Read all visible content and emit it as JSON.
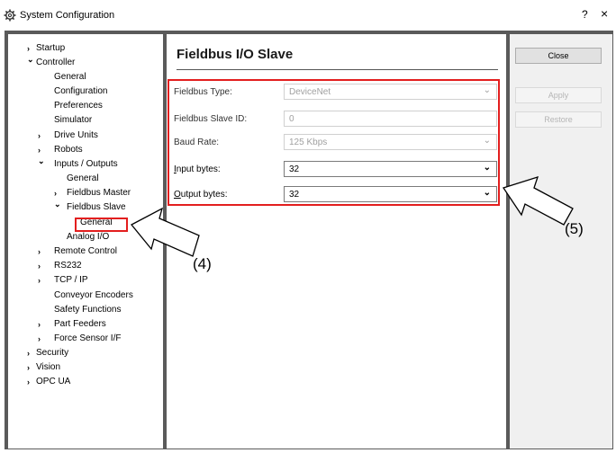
{
  "window": {
    "title": "System Configuration",
    "help": "?",
    "close": "×"
  },
  "tree": {
    "items": [
      {
        "label": "Startup",
        "chevron": "›"
      },
      {
        "label": "Controller",
        "chevron": "⌄"
      },
      {
        "label": "General"
      },
      {
        "label": "Configuration"
      },
      {
        "label": "Preferences"
      },
      {
        "label": "Simulator"
      },
      {
        "label": "Drive Units",
        "chevron": "›"
      },
      {
        "label": "Robots",
        "chevron": "›"
      },
      {
        "label": "Inputs / Outputs",
        "chevron": "⌄"
      },
      {
        "label": "General"
      },
      {
        "label": "Fieldbus Master",
        "chevron": "›"
      },
      {
        "label": "Fieldbus Slave",
        "chevron": "⌄"
      },
      {
        "label": "General",
        "selected": true
      },
      {
        "label": "Analog I/O"
      },
      {
        "label": "Remote Control",
        "chevron": "›"
      },
      {
        "label": "RS232",
        "chevron": "›"
      },
      {
        "label": "TCP / IP",
        "chevron": "›"
      },
      {
        "label": "Conveyor Encoders"
      },
      {
        "label": "Safety Functions"
      },
      {
        "label": "Part Feeders",
        "chevron": "›"
      },
      {
        "label": "Force Sensor I/F",
        "chevron": "›"
      },
      {
        "label": "Security",
        "chevron": "›"
      },
      {
        "label": "Vision",
        "chevron": "›"
      },
      {
        "label": "OPC UA",
        "chevron": "›"
      }
    ]
  },
  "main": {
    "title": "Fieldbus I/O Slave",
    "fields": [
      {
        "label": "Fieldbus Type:",
        "value": "DeviceNet",
        "enabled": false,
        "dropdown": true
      },
      {
        "label": "Fieldbus Slave ID:",
        "value": "0",
        "enabled": false,
        "dropdown": false
      },
      {
        "label": "Baud Rate:",
        "value": "125 Kbps",
        "enabled": false,
        "dropdown": true
      },
      {
        "label": "Input bytes:",
        "value": "32",
        "enabled": true,
        "dropdown": true
      },
      {
        "label": "Output bytes:",
        "value": "32",
        "enabled": true,
        "dropdown": true
      }
    ]
  },
  "buttons": {
    "close": "Close",
    "apply": "Apply",
    "restore": "Restore"
  },
  "annotations": {
    "callout_4": "(4)",
    "callout_5": "(5)"
  },
  "colors": {
    "highlight": "#e31e1e",
    "frame": "#5a5a5a"
  }
}
